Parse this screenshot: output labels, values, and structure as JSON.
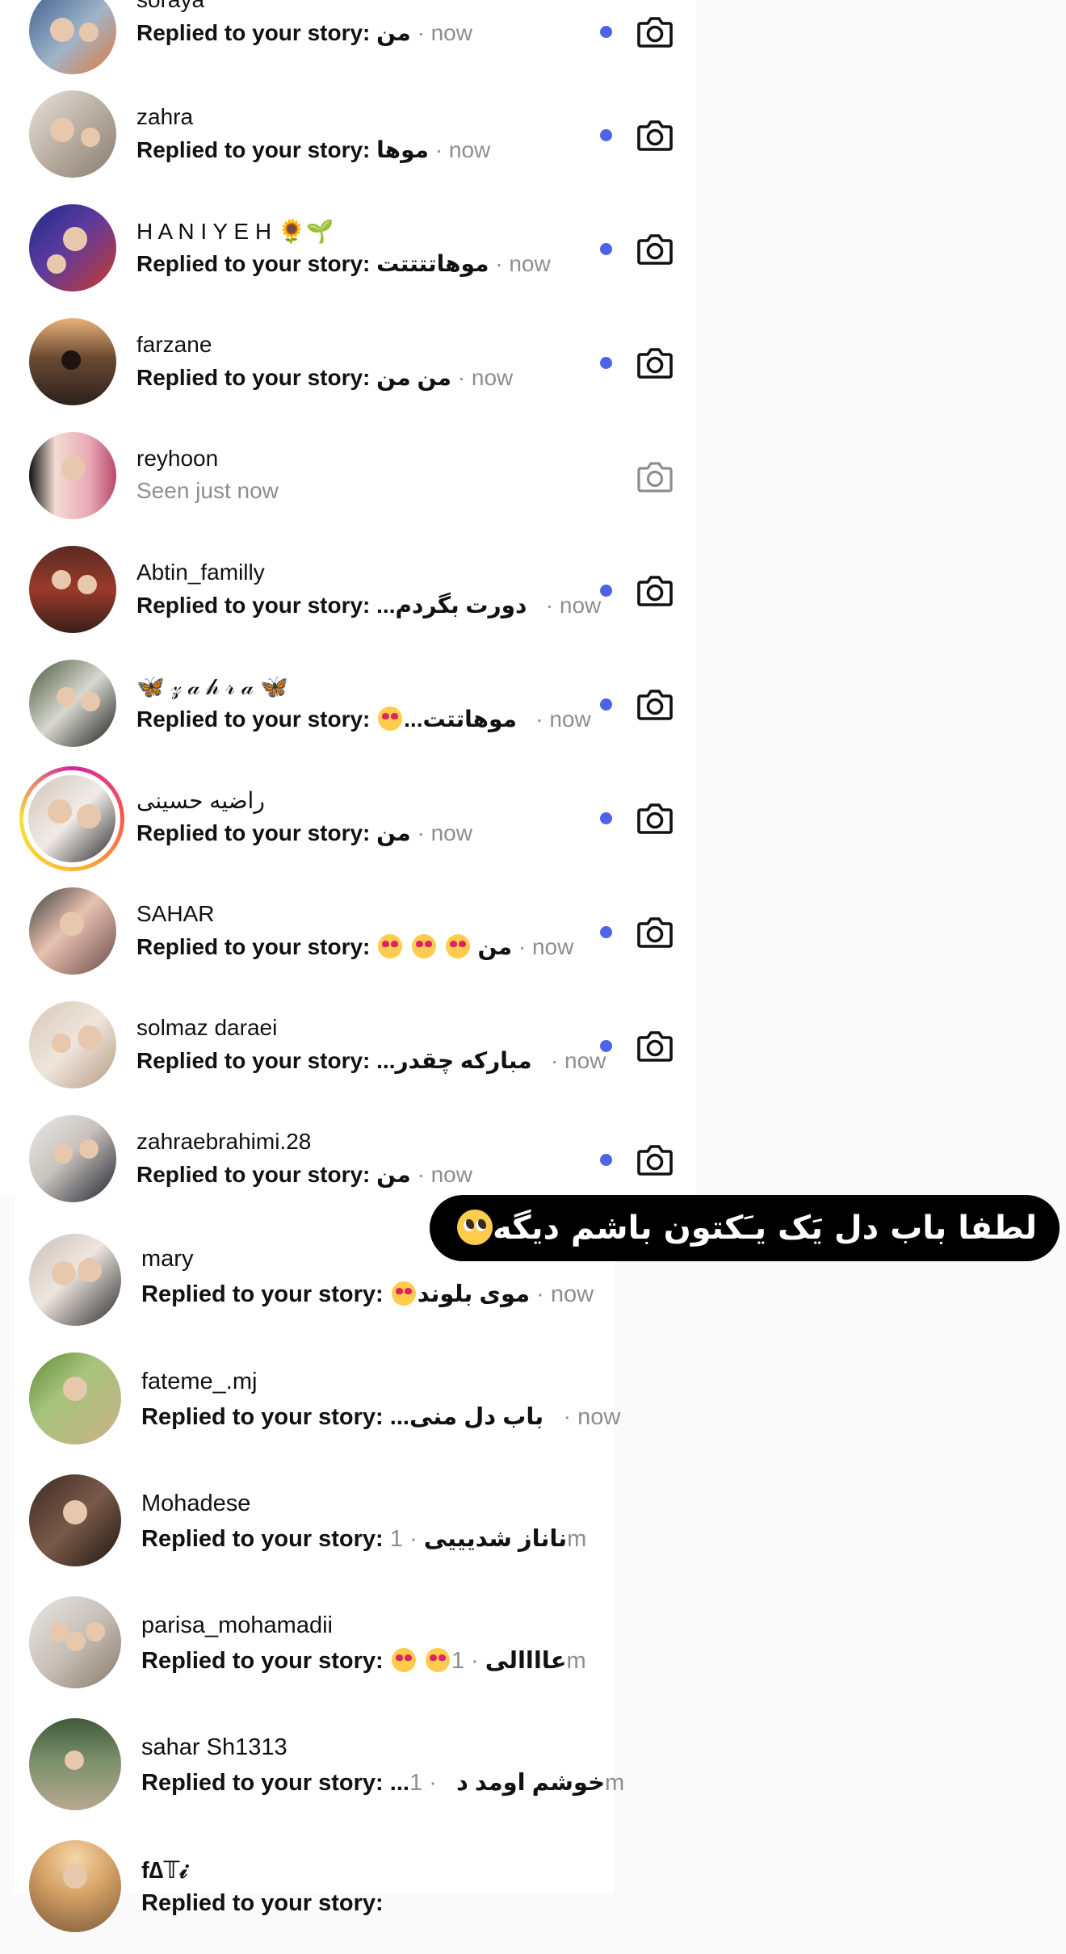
{
  "messages": [
    {
      "username": "soraya",
      "preview_label": "Replied to your story:",
      "preview_text": "من",
      "time": "now",
      "seen": false
    },
    {
      "username": "zahra",
      "preview_label": "Replied to your story:",
      "preview_text": "موها",
      "time": "now",
      "seen": false
    },
    {
      "username": "H A N I Y E H 🌻🌱",
      "preview_label": "Replied to your story:",
      "preview_text": "موهاتتتتت",
      "time": "now",
      "seen": false
    },
    {
      "username": "farzane",
      "preview_label": "Replied to your story:",
      "preview_text": "من من",
      "time": "now",
      "seen": false
    },
    {
      "username": "reyhoon",
      "status_text": "Seen just now",
      "seen": true
    },
    {
      "username": "Abtin_familly",
      "preview_label": "Replied to your story:",
      "preview_text": "...دورت بگردم",
      "time": "now",
      "seen": false
    },
    {
      "username": "🦋 𝓏 𝒶 𝒽 𝓇 𝒶 🦋",
      "preview_label": "Replied to your story:",
      "preview_text": "...موهاتتت",
      "time": "now",
      "seen": false
    },
    {
      "username": "راضیه حسینی",
      "preview_label": "Replied to your story:",
      "preview_text": "من",
      "time": "now",
      "seen": false,
      "story_ring": true
    },
    {
      "username": "SAHAR",
      "preview_label": "Replied to your story:",
      "preview_text": "من",
      "time": "now",
      "seen": false
    },
    {
      "username": "solmaz daraei",
      "preview_label": "Replied to your story:",
      "preview_text": "...مبارکه چقدر",
      "time": "now",
      "seen": false
    },
    {
      "username": "zahraebrahimi.28",
      "preview_label": "Replied to your story:",
      "preview_text": "من",
      "time": "now",
      "seen": false
    }
  ],
  "messages_lower": [
    {
      "username": "mary",
      "preview_label": "Replied to your story:",
      "preview_text": "موی بلوند",
      "time": "now"
    },
    {
      "username": "fateme_.mj",
      "preview_label": "Replied to your story:",
      "preview_text": "...باب دل منی",
      "time": "now"
    },
    {
      "username": "Mohadese",
      "preview_label": "Replied to your story:",
      "preview_text": "ناناز شدیییی",
      "time": "1m"
    },
    {
      "username": "parisa_mohamadii",
      "preview_label": "Replied to your story:",
      "preview_text": "عاااالی",
      "time": "1m"
    },
    {
      "username": "sahar Sh1313",
      "preview_label": "Replied to your story:",
      "preview_text": "...خوشم اومد د",
      "time": "1m"
    },
    {
      "username": "f∆𝕋𝒾",
      "preview_label": "Replied to your story:",
      "preview_text": "",
      "time": ""
    }
  ],
  "caption": {
    "text": "لطفا باب دل یَک یـَکتون باشم دیگه"
  },
  "icons": {
    "camera": "camera-icon",
    "unread": "unread-dot",
    "emoji_heart_eyes": "heart-eyes-emoji",
    "emoji_pleading": "pleading-face-emoji"
  },
  "colors": {
    "unread_dot": "#4f63e8",
    "secondary_text": "#8e8e8e",
    "caption_bg": "#000000",
    "caption_fg": "#ffffff"
  }
}
